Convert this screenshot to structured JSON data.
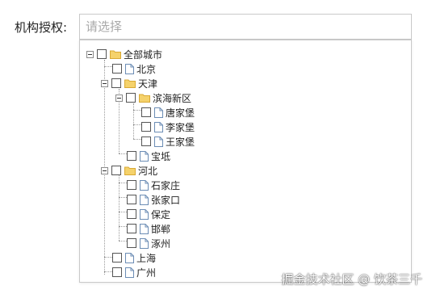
{
  "form": {
    "label": "机构授权:",
    "placeholder": "请选择"
  },
  "tree": {
    "root": {
      "label": "全部城市",
      "children": [
        {
          "label": "北京"
        },
        {
          "label": "天津",
          "children": [
            {
              "label": "滨海新区",
              "children": [
                {
                  "label": "唐家堡"
                },
                {
                  "label": "李家堡"
                },
                {
                  "label": "王家堡"
                }
              ]
            },
            {
              "label": "宝坻"
            }
          ]
        },
        {
          "label": "河北",
          "children": [
            {
              "label": "石家庄"
            },
            {
              "label": "张家口"
            },
            {
              "label": "保定"
            },
            {
              "label": "邯郸"
            },
            {
              "label": "涿州"
            }
          ]
        },
        {
          "label": "上海"
        },
        {
          "label": "广州"
        }
      ]
    }
  },
  "watermark": "掘金技术社区 @ 饮茶三千",
  "colors": {
    "folder": "#f5d26b",
    "folder_edge": "#d9a934",
    "file_edge": "#6c8db5",
    "border": "#c9c9c9"
  }
}
